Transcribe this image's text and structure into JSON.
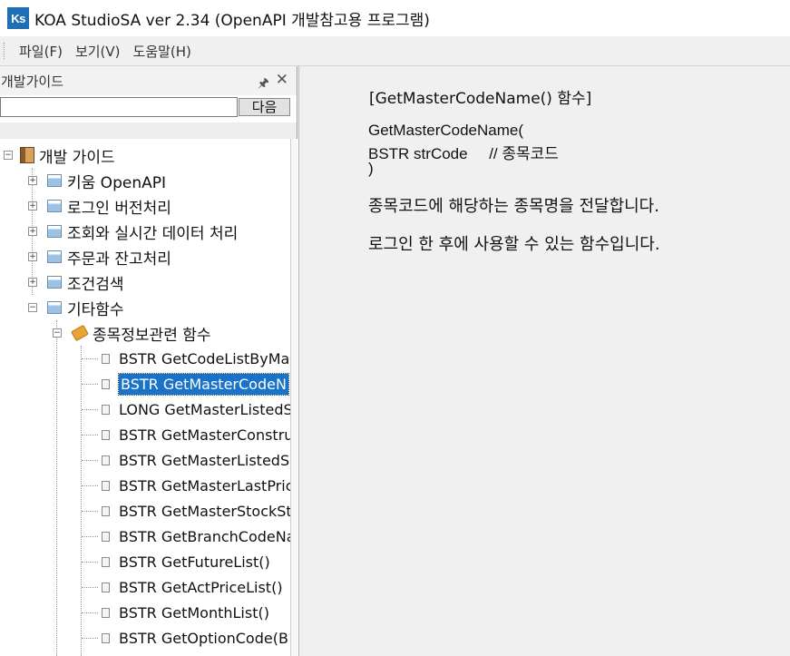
{
  "window": {
    "app_icon_text": "Ks",
    "title": "KOA StudioSA ver 2.34  (OpenAPI 개발참고용 프로그램)"
  },
  "menu": [
    "파일(F)",
    "보기(V)",
    "도움말(H)"
  ],
  "left_panel": {
    "title": "개발가이드",
    "pin_glyph": "📌",
    "close_glyph": "✕",
    "search_value": "",
    "next_button_label": "다음"
  },
  "tree": {
    "root": "개발 가이드",
    "categories": [
      "키움 OpenAPI",
      "로그인 버전처리",
      "조회와 실시간 데이터 처리",
      "주문과 잔고처리",
      "조건검색",
      "기타함수"
    ],
    "subcategory": "종목정보관련 함수",
    "items": [
      "BSTR GetCodeListByMa",
      "BSTR GetMasterCodeN",
      "LONG GetMasterListedS",
      "BSTR GetMasterConstru",
      "BSTR GetMasterListedS",
      "BSTR GetMasterLastPric",
      "BSTR GetMasterStockSt",
      "BSTR GetBranchCodeNa",
      "BSTR GetFutureList()",
      "BSTR GetActPriceList()",
      "BSTR GetMonthList()",
      "BSTR GetOptionCode(B"
    ],
    "selected_index": 1
  },
  "content": {
    "heading": "[GetMasterCodeName() 함수]",
    "code_lines": [
      "GetMasterCodeName(",
      "BSTR strCode     // 종목코드",
      ")"
    ],
    "description_lines": [
      "종목코드에 해당하는 종목명을 전달합니다.",
      "로그인 한 후에 사용할 수 있는 함수입니다."
    ]
  },
  "colors": {
    "selection": "#1a73c9",
    "app_icon": "#1f6fb5",
    "content_bg": "#f0f0f0"
  }
}
